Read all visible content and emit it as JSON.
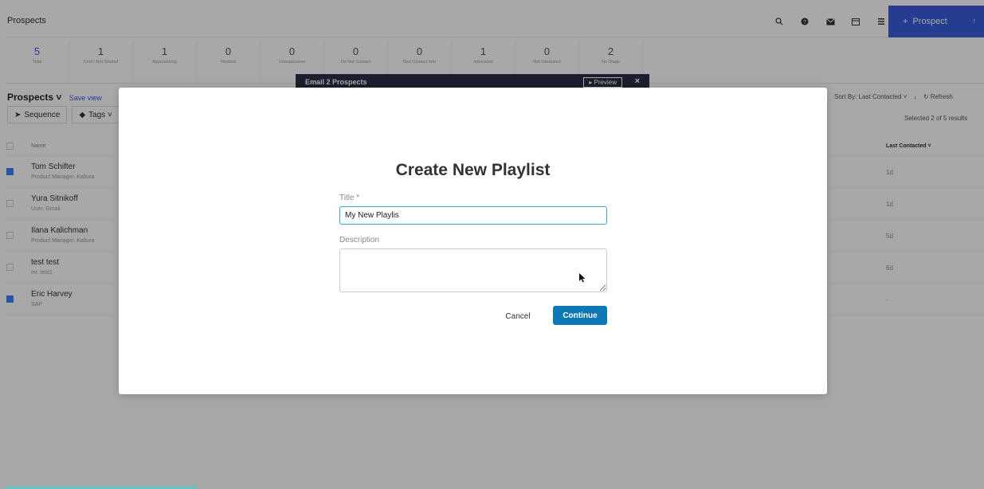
{
  "app": {
    "title": "Prospects",
    "top_icons": [
      "search-icon",
      "help-icon",
      "mail-icon",
      "calendar-icon",
      "settings-icon"
    ],
    "primary_button": {
      "plus": "+",
      "label": "Prospect",
      "caret": "↑"
    },
    "accent_color": "#3b5bdb"
  },
  "stats": [
    {
      "count": "5",
      "label": "Total"
    },
    {
      "count": "1",
      "label": "Cold / Not Started"
    },
    {
      "count": "1",
      "label": "Approaching"
    },
    {
      "count": "0",
      "label": "Replied"
    },
    {
      "count": "0",
      "label": "Unresponsive"
    },
    {
      "count": "0",
      "label": "Do Not Contact"
    },
    {
      "count": "0",
      "label": "Bad Contact Info"
    },
    {
      "count": "1",
      "label": "Interested"
    },
    {
      "count": "0",
      "label": "Not Interested"
    },
    {
      "count": "2",
      "label": "No Stage"
    }
  ],
  "list": {
    "heading": "Prospects ˅",
    "save_view": "Save view",
    "filters": [
      "Sequence",
      "Tags ˅"
    ],
    "sort_label": "Sort By: Last Contacted ˅",
    "refresh": "Refresh",
    "selected_info": "Selected 2 of 5 results",
    "col_name": "Name",
    "col_last": "Last Contacted ˅",
    "rows": [
      {
        "name": "Tom Schifter",
        "sub": "Product Manager, Kaltura",
        "last": "1d",
        "checked": true
      },
      {
        "name": "Yura Sitnikoff",
        "sub": "User, Gmail",
        "last": "1d",
        "checked": false
      },
      {
        "name": "Ilana Kalichman",
        "sub": "Product Manager, Kaltura",
        "last": "5d",
        "checked": false
      },
      {
        "name": "test test",
        "sub": "mr, test1",
        "last": "6d",
        "checked": false
      },
      {
        "name": "Eric Harvey",
        "sub": "SAP",
        "last": "-",
        "checked": true
      }
    ]
  },
  "email_panel": {
    "title": "Email 2 Prospects",
    "preview": "▸ Preview",
    "close": "×"
  },
  "modal": {
    "title": "Create New Playlist",
    "title_label": "Title *",
    "title_value": "My New Playlis",
    "description_label": "Description",
    "description_value": "",
    "cancel": "Cancel",
    "continue": "Continue",
    "continue_color": "#0f77b5"
  }
}
